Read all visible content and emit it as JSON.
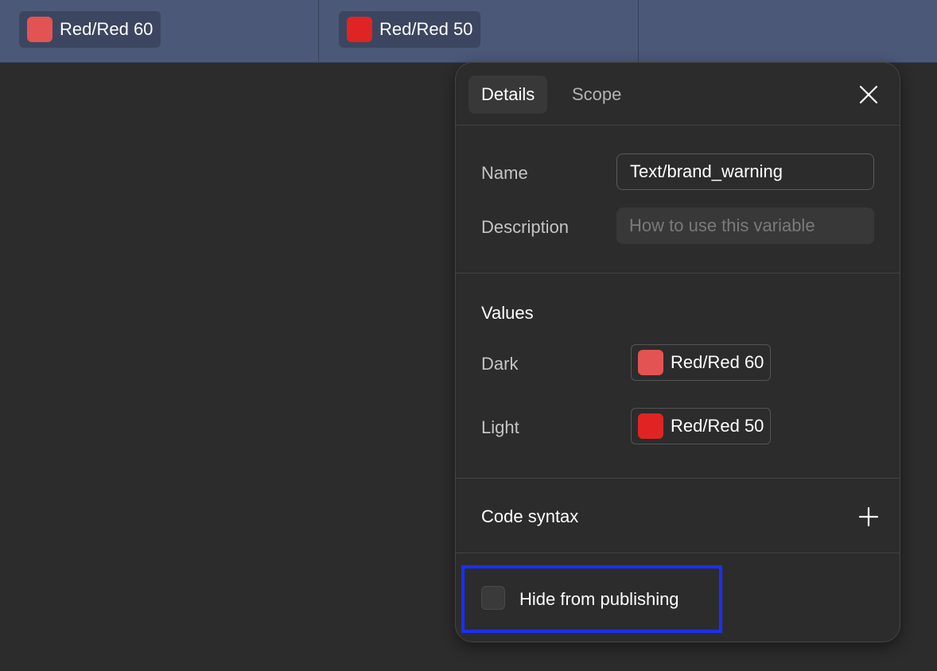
{
  "top_row": [
    {
      "label": "Red/Red 60",
      "color": "#e45353"
    },
    {
      "label": "Red/Red 50",
      "color": "#e02424"
    }
  ],
  "panel": {
    "tabs": {
      "details": "Details",
      "scope": "Scope"
    },
    "close_icon": "close-icon",
    "name": {
      "label": "Name",
      "value": "Text/brand_warning"
    },
    "description": {
      "label": "Description",
      "placeholder": "How to use this variable"
    },
    "values": {
      "title": "Values",
      "modes": [
        {
          "label": "Dark",
          "value": "Red/Red 60",
          "color": "#e45353"
        },
        {
          "label": "Light",
          "value": "Red/Red 50",
          "color": "#e02424"
        }
      ]
    },
    "code_syntax": {
      "title": "Code syntax",
      "add_icon": "plus-icon"
    },
    "hide_from_publishing": {
      "label": "Hide from publishing",
      "checked": false
    }
  },
  "colors": {
    "highlight": "#1a2fff",
    "topbar": "#4b5878"
  }
}
